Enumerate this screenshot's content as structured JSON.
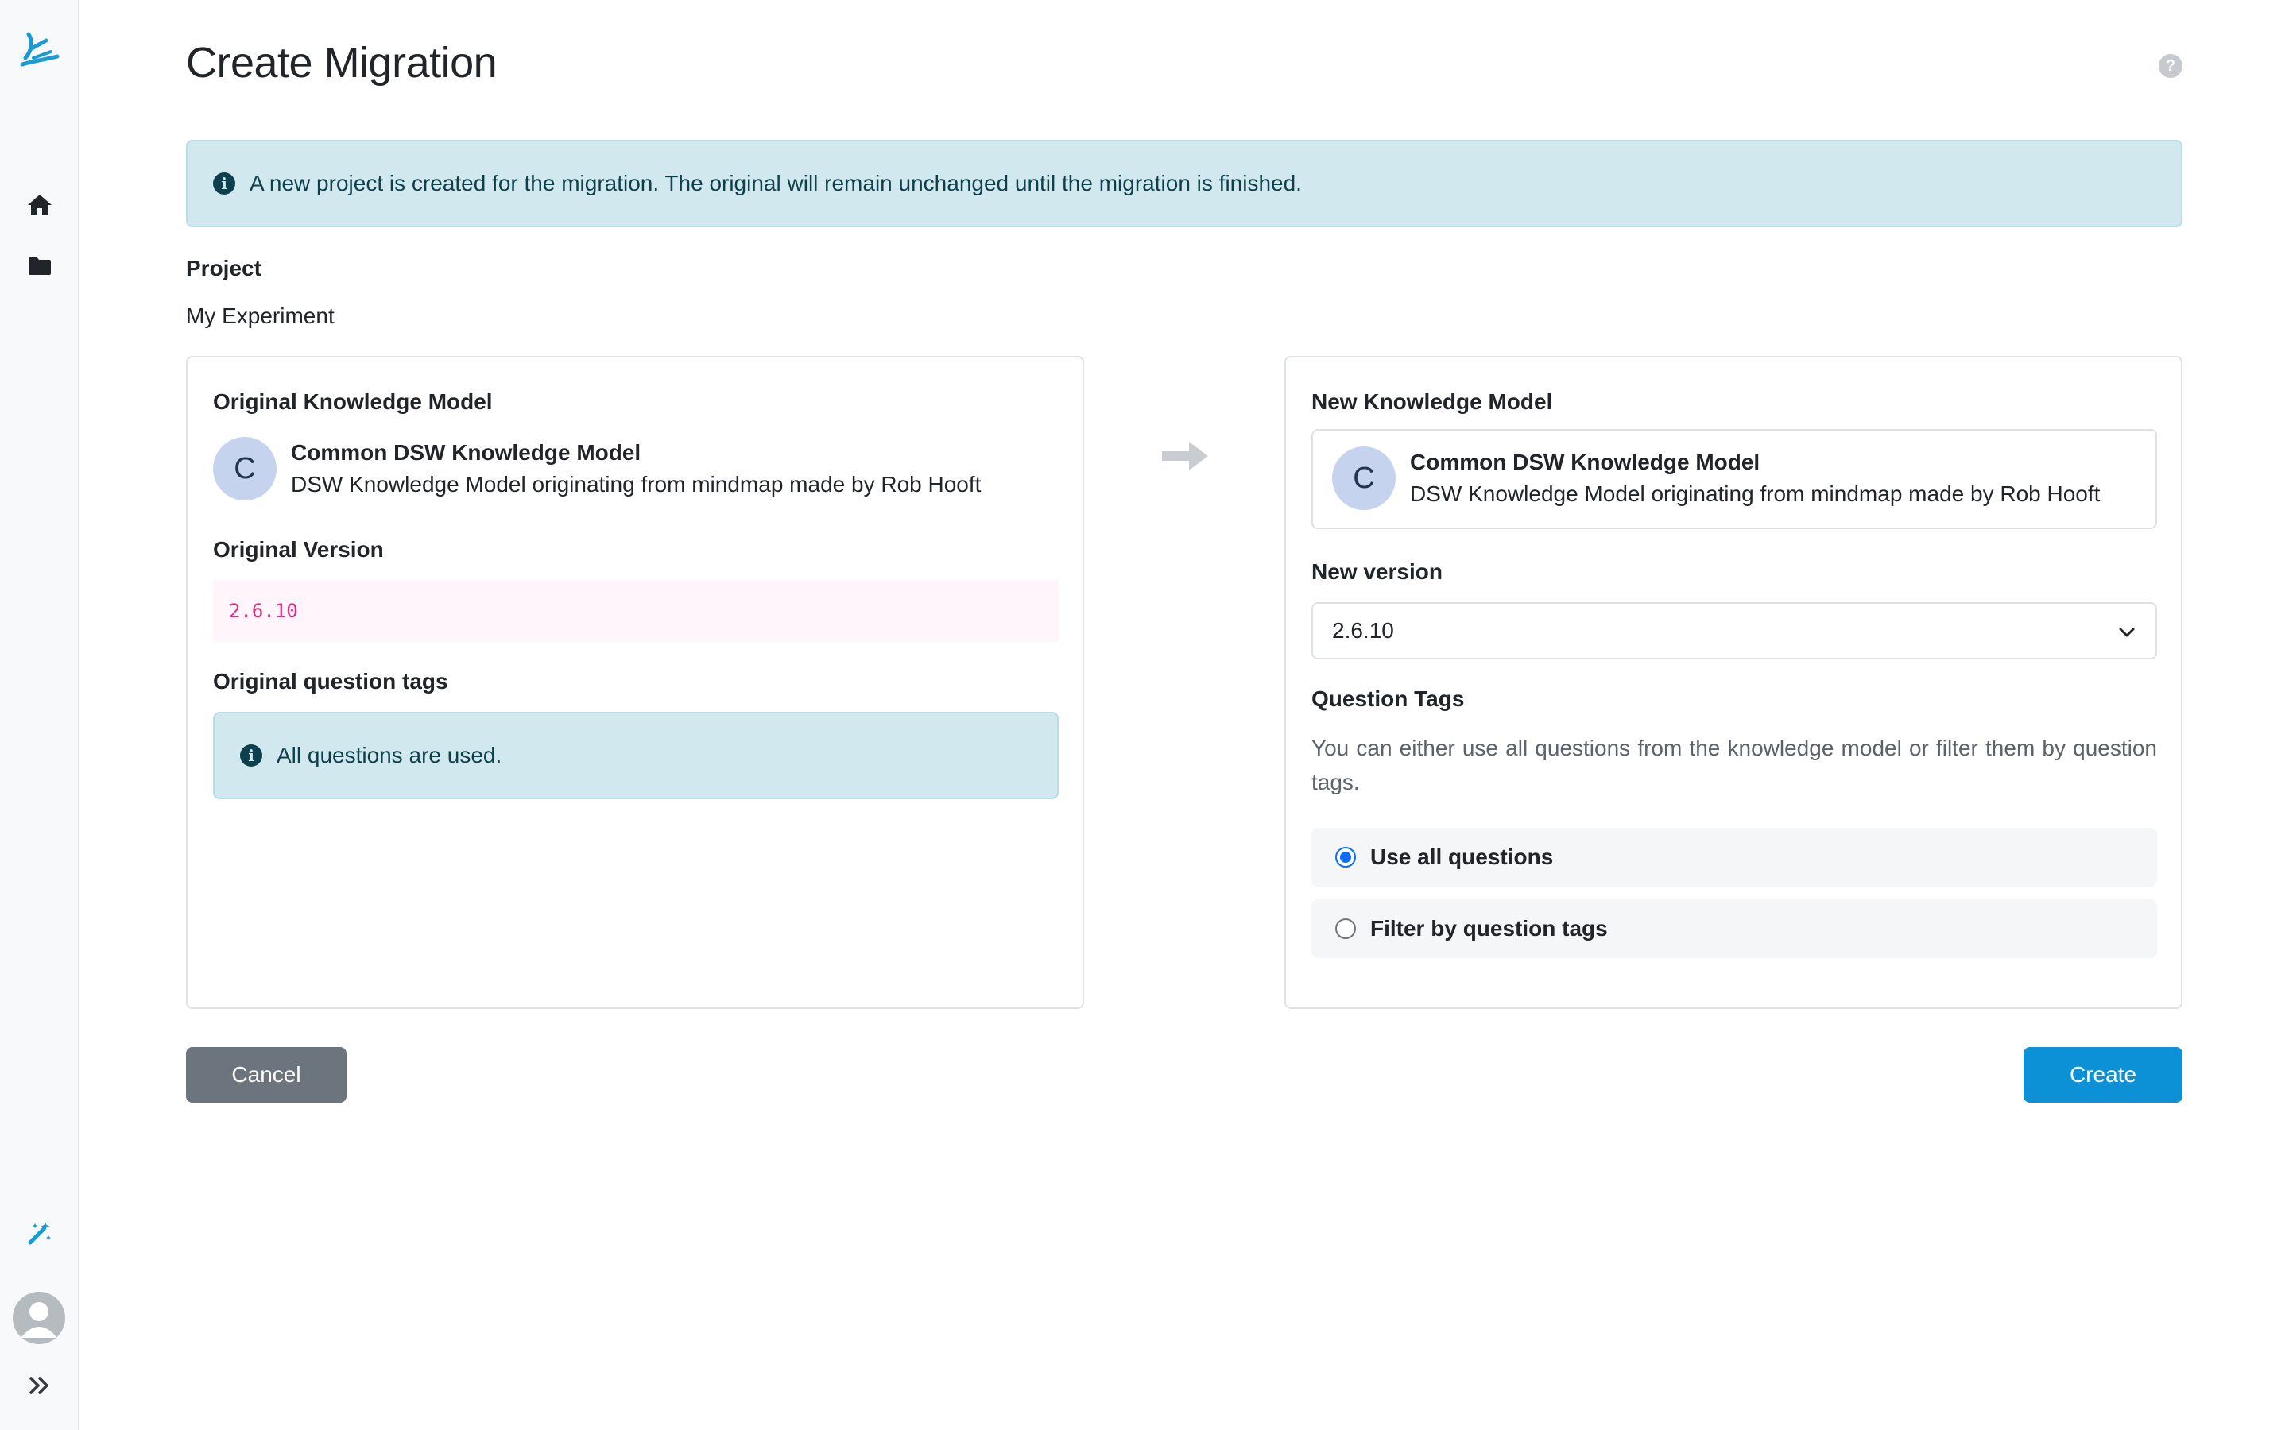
{
  "header": {
    "title": "Create Migration"
  },
  "notice": {
    "text": "A new project is created for the migration. The original will remain unchanged until the migration is finished."
  },
  "project": {
    "label": "Project",
    "name": "My Experiment"
  },
  "original": {
    "heading": "Original Knowledge Model",
    "km": {
      "initial": "C",
      "name": "Common DSW Knowledge Model",
      "description": "DSW Knowledge Model originating from mindmap made by Rob Hooft"
    },
    "version_label": "Original Version",
    "version": "2.6.10",
    "tags_label": "Original question tags",
    "tags_notice": "All questions are used."
  },
  "target": {
    "heading": "New Knowledge Model",
    "km": {
      "initial": "C",
      "name": "Common DSW Knowledge Model",
      "description": "DSW Knowledge Model originating from mindmap made by Rob Hooft"
    },
    "version_label": "New version",
    "version_selected": "2.6.10",
    "tags_label": "Question Tags",
    "tags_help": "You can either use all questions from the knowledge model or filter them by question tags.",
    "options": [
      {
        "label": "Use all questions",
        "checked": true
      },
      {
        "label": "Filter by question tags",
        "checked": false
      }
    ]
  },
  "actions": {
    "cancel": "Cancel",
    "create": "Create"
  },
  "colors": {
    "accent": "#0c91d6",
    "secondary": "#6c757d",
    "info_bg": "#d1e9ee",
    "code": "#d63384"
  }
}
